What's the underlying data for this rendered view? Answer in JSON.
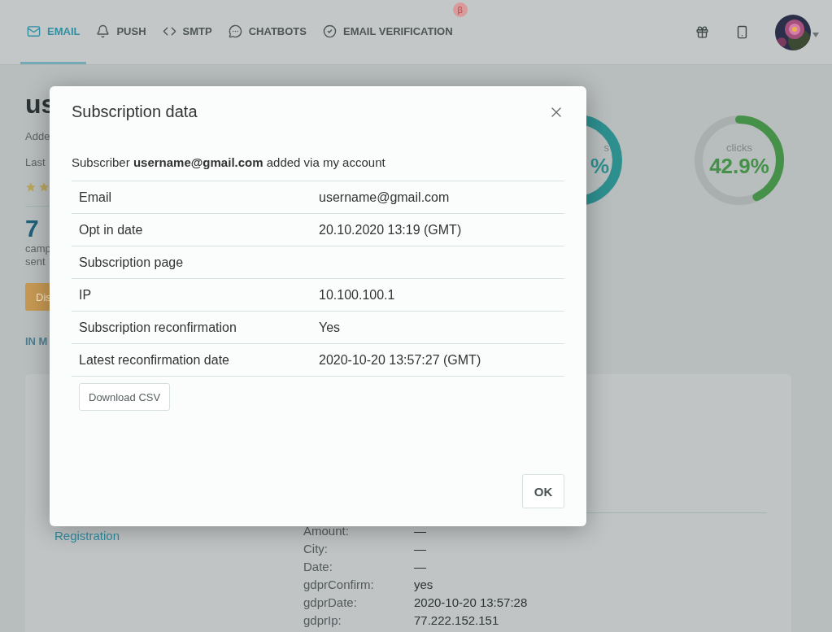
{
  "header": {
    "tabs": [
      {
        "label": "EMAIL",
        "selected": true
      },
      {
        "label": "PUSH",
        "selected": false
      },
      {
        "label": "SMTP",
        "selected": false
      },
      {
        "label": "CHATBOTS",
        "selected": false
      },
      {
        "label": "EMAIL VERIFICATION",
        "selected": false,
        "badge": "β"
      }
    ]
  },
  "profile": {
    "title": "us",
    "added": "Adde",
    "last": "Last",
    "count": "7",
    "count_lines": [
      "camp",
      "sent"
    ],
    "button": "Dis",
    "section": "IN M"
  },
  "rings": [
    {
      "label": "s",
      "value": "%",
      "color": "#2e8f8f"
    },
    {
      "label": "clicks",
      "value": "42.9%",
      "level": 0.429,
      "color": "#46914a"
    }
  ],
  "card": {
    "link": "Registration",
    "fields": [
      {
        "key": "Amount:",
        "value": "—"
      },
      {
        "key": "City:",
        "value": "—"
      },
      {
        "key": "Date:",
        "value": "—"
      },
      {
        "key": "gdprConfirm:",
        "value": "yes"
      },
      {
        "key": "gdprDate:",
        "value": "2020-10-20 13:57:28"
      },
      {
        "key": "gdprIp:",
        "value": "77.222.152.151"
      }
    ]
  },
  "dialog": {
    "title": "Subscription data",
    "intro": "Subscriber **username@gmail.com** added via my account",
    "rows": [
      {
        "label": "Email",
        "value": "username@gmail.com"
      },
      {
        "label": "Opt in date",
        "value": "20.10.2020 13:19 (GMT)"
      },
      {
        "label": "Subscription page"
      },
      {
        "label": "IP",
        "value": "10.100.100.1"
      },
      {
        "label": "Subscription reconfirmation",
        "value": "Yes"
      },
      {
        "label": "Latest reconfirmation date",
        "value": "2020-10-20 13:57:27 (GMT)"
      }
    ],
    "download": "Download CSV",
    "ok": "OK"
  }
}
